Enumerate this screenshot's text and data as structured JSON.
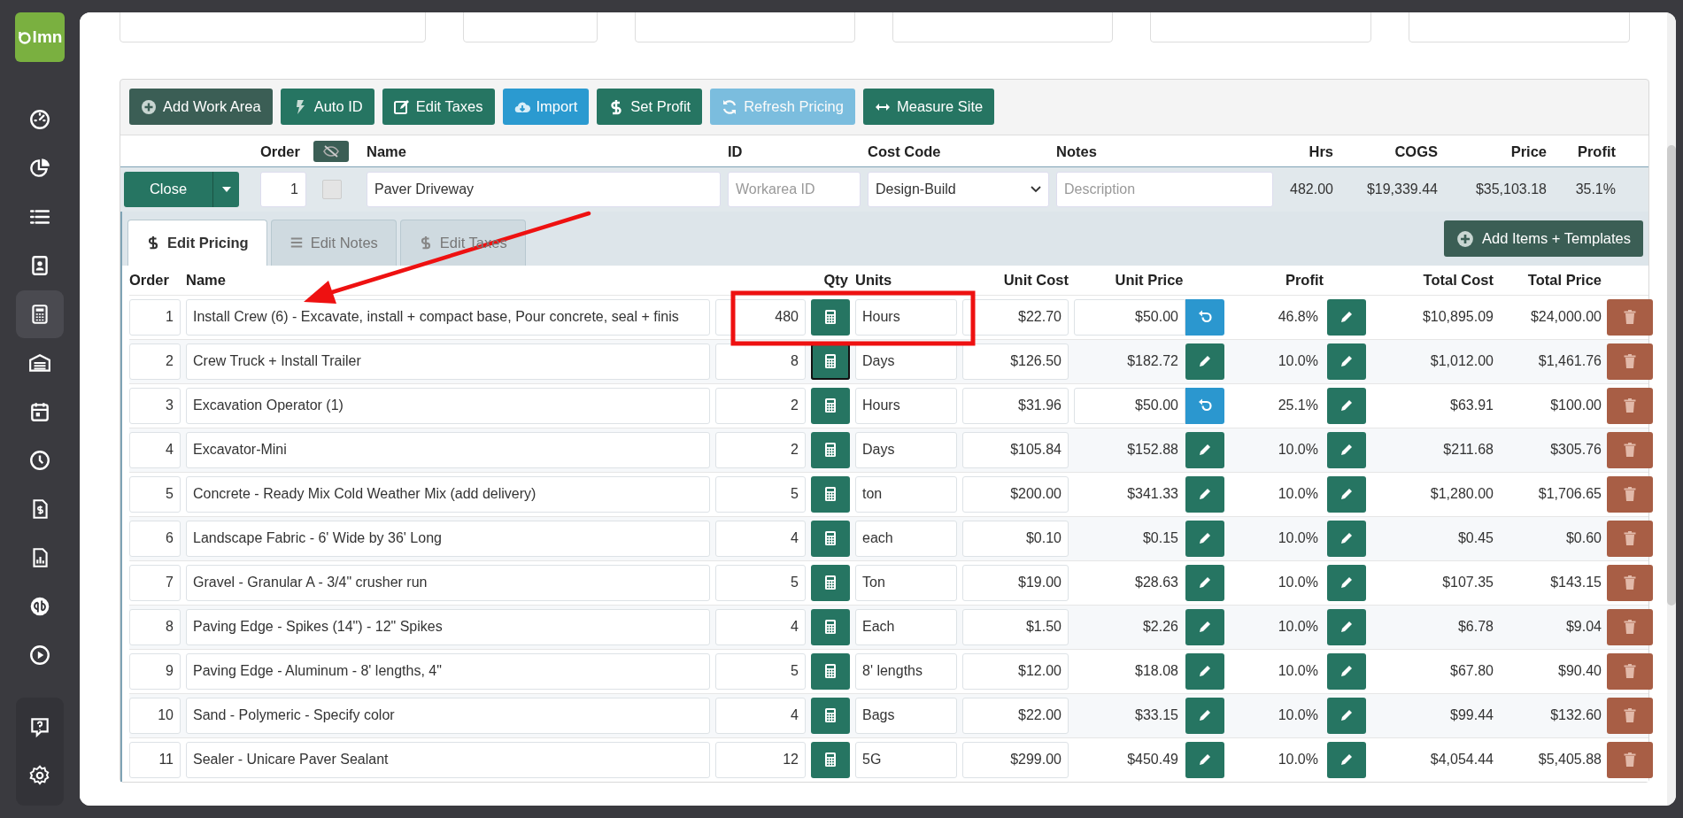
{
  "sidebar": {
    "logo": "lmn",
    "items": [
      {
        "kind": "gauge",
        "selected": false
      },
      {
        "kind": "pie",
        "selected": false
      },
      {
        "kind": "list",
        "selected": false
      },
      {
        "kind": "badge",
        "selected": false
      },
      {
        "kind": "calculator",
        "selected": true
      },
      {
        "kind": "warehouse",
        "selected": false
      },
      {
        "kind": "calendar",
        "selected": false
      },
      {
        "kind": "clock",
        "selected": false
      },
      {
        "kind": "invoice",
        "selected": false
      },
      {
        "kind": "report",
        "selected": false
      },
      {
        "kind": "qb",
        "selected": false
      },
      {
        "kind": "play",
        "selected": false
      }
    ],
    "bottom_items": [
      {
        "kind": "help",
        "selected": false
      },
      {
        "kind": "settings",
        "selected": false
      }
    ]
  },
  "toolbar": [
    {
      "label": "Add Work Area",
      "kind": "plus",
      "disabled": false
    },
    {
      "label": "Auto ID",
      "kind": "bolt",
      "disabled": false
    },
    {
      "label": "Edit Taxes",
      "kind": "edit",
      "disabled": false
    },
    {
      "label": "Import",
      "kind": "cloud",
      "disabled": false
    },
    {
      "label": "Set Profit",
      "kind": "dollar",
      "disabled": false
    },
    {
      "label": "Refresh Pricing",
      "kind": "refresh",
      "disabled": true
    },
    {
      "label": "Measure Site",
      "kind": "arrows",
      "disabled": false
    }
  ],
  "work_area": {
    "columns": [
      "Order",
      "Name",
      "ID",
      "Cost Code",
      "Notes",
      "Hrs",
      "COGS",
      "Price",
      "Profit"
    ],
    "close_button": "Close",
    "order": "1",
    "checked": false,
    "name": "Paver Driveway",
    "id_placeholder": "Workarea ID",
    "cost_code": "Design-Build",
    "notes_placeholder": "Description",
    "hrs": "482.00",
    "cogs": "$19,339.44",
    "price": "$35,103.18",
    "profit": "35.1%"
  },
  "tabs": [
    {
      "label": "Edit Pricing",
      "selected": true
    },
    {
      "label": "Edit Notes",
      "selected": false
    },
    {
      "label": "Edit Taxes",
      "selected": false
    }
  ],
  "add_items_button": "Add Items + Templates",
  "items": {
    "columns": [
      "Order",
      "Name",
      "Qty",
      "Units",
      "Unit Cost",
      "Unit Price",
      "Profit",
      "Total Cost",
      "Total Price"
    ],
    "rows": [
      {
        "order": "1",
        "name": "Install Crew (6) - Excavate, install + compact base, Pour concrete, seal + finis",
        "qty": "480",
        "focused": false,
        "units": "Hours",
        "unit_cost": "$22.70",
        "unit_price": "$50.00",
        "kind": "override",
        "profit": "46.8%",
        "total_cost": "$10,895.09",
        "total_price": "$24,000.00"
      },
      {
        "order": "2",
        "name": "Crew Truck + Install Trailer",
        "qty": "8",
        "focused": true,
        "units": "Days",
        "unit_cost": "$126.50",
        "unit_price": "$182.72",
        "kind": "computed",
        "profit": "10.0%",
        "total_cost": "$1,012.00",
        "total_price": "$1,461.76"
      },
      {
        "order": "3",
        "name": "Excavation Operator (1)",
        "qty": "2",
        "focused": false,
        "units": "Hours",
        "unit_cost": "$31.96",
        "unit_price": "$50.00",
        "kind": "override",
        "profit": "25.1%",
        "total_cost": "$63.91",
        "total_price": "$100.00"
      },
      {
        "order": "4",
        "name": "Excavator-Mini",
        "qty": "2",
        "focused": false,
        "units": "Days",
        "unit_cost": "$105.84",
        "unit_price": "$152.88",
        "kind": "computed",
        "profit": "10.0%",
        "total_cost": "$211.68",
        "total_price": "$305.76"
      },
      {
        "order": "5",
        "name": "Concrete - Ready Mix Cold Weather Mix (add delivery)",
        "qty": "5",
        "focused": false,
        "units": "ton",
        "unit_cost": "$200.00",
        "unit_price": "$341.33",
        "kind": "computed",
        "profit": "10.0%",
        "total_cost": "$1,280.00",
        "total_price": "$1,706.65"
      },
      {
        "order": "6",
        "name": "Landscape Fabric - 6' Wide by 36' Long",
        "qty": "4",
        "focused": false,
        "units": "each",
        "unit_cost": "$0.10",
        "unit_price": "$0.15",
        "kind": "computed",
        "profit": "10.0%",
        "total_cost": "$0.45",
        "total_price": "$0.60"
      },
      {
        "order": "7",
        "name": "Gravel - Granular A - 3/4\" crusher run",
        "qty": "5",
        "focused": false,
        "units": "Ton",
        "unit_cost": "$19.00",
        "unit_price": "$28.63",
        "kind": "computed",
        "profit": "10.0%",
        "total_cost": "$107.35",
        "total_price": "$143.15"
      },
      {
        "order": "8",
        "name": "Paving Edge - Spikes (14\") - 12\" Spikes",
        "qty": "4",
        "focused": false,
        "units": "Each",
        "unit_cost": "$1.50",
        "unit_price": "$2.26",
        "kind": "computed",
        "profit": "10.0%",
        "total_cost": "$6.78",
        "total_price": "$9.04"
      },
      {
        "order": "9",
        "name": "Paving Edge - Aluminum - 8' lengths, 4\"",
        "qty": "5",
        "focused": false,
        "units": "8' lengths",
        "unit_cost": "$12.00",
        "unit_price": "$18.08",
        "kind": "computed",
        "profit": "10.0%",
        "total_cost": "$67.80",
        "total_price": "$90.40"
      },
      {
        "order": "10",
        "name": "Sand - Polymeric - Specify color",
        "qty": "4",
        "focused": false,
        "units": "Bags",
        "unit_cost": "$22.00",
        "unit_price": "$33.15",
        "kind": "computed",
        "profit": "10.0%",
        "total_cost": "$99.44",
        "total_price": "$132.60"
      },
      {
        "order": "11",
        "name": "Sealer - Unicare Paver Sealant",
        "qty": "12",
        "focused": false,
        "units": "5G",
        "unit_cost": "$299.00",
        "unit_price": "$450.49",
        "kind": "computed",
        "profit": "10.0%",
        "total_cost": "$4,054.44",
        "total_price": "$5,405.88"
      }
    ]
  }
}
